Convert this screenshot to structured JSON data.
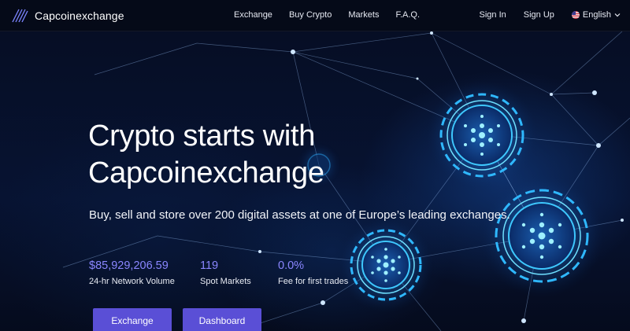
{
  "brand": {
    "name": "Capcoinexchange",
    "logo_icon": "layered-stripes-logo-icon"
  },
  "nav": {
    "links": [
      "Exchange",
      "Buy Crypto",
      "Markets",
      "F.A.Q."
    ],
    "sign_in": "Sign In",
    "sign_up": "Sign Up",
    "language": "English",
    "language_icon": "us-flag-icon"
  },
  "hero": {
    "title_line1": "Crypto starts with",
    "title_line2": "Capcoinexchange",
    "subtitle": "Buy, sell and store over 200 digital assets at one of Europe’s leading exchanges."
  },
  "stats": [
    {
      "value": "$85,929,206.59",
      "label": "24-hr Network Volume"
    },
    {
      "value": "119",
      "label": "Spot Markets"
    },
    {
      "value": "0.0%",
      "label": "Fee for first trades"
    }
  ],
  "buttons": {
    "exchange": "Exchange",
    "dashboard": "Dashboard"
  },
  "colors": {
    "accent": "#5a4fd6",
    "stat_value": "#8a86ff",
    "background": "#040a1a",
    "glow": "#39c6ff"
  }
}
